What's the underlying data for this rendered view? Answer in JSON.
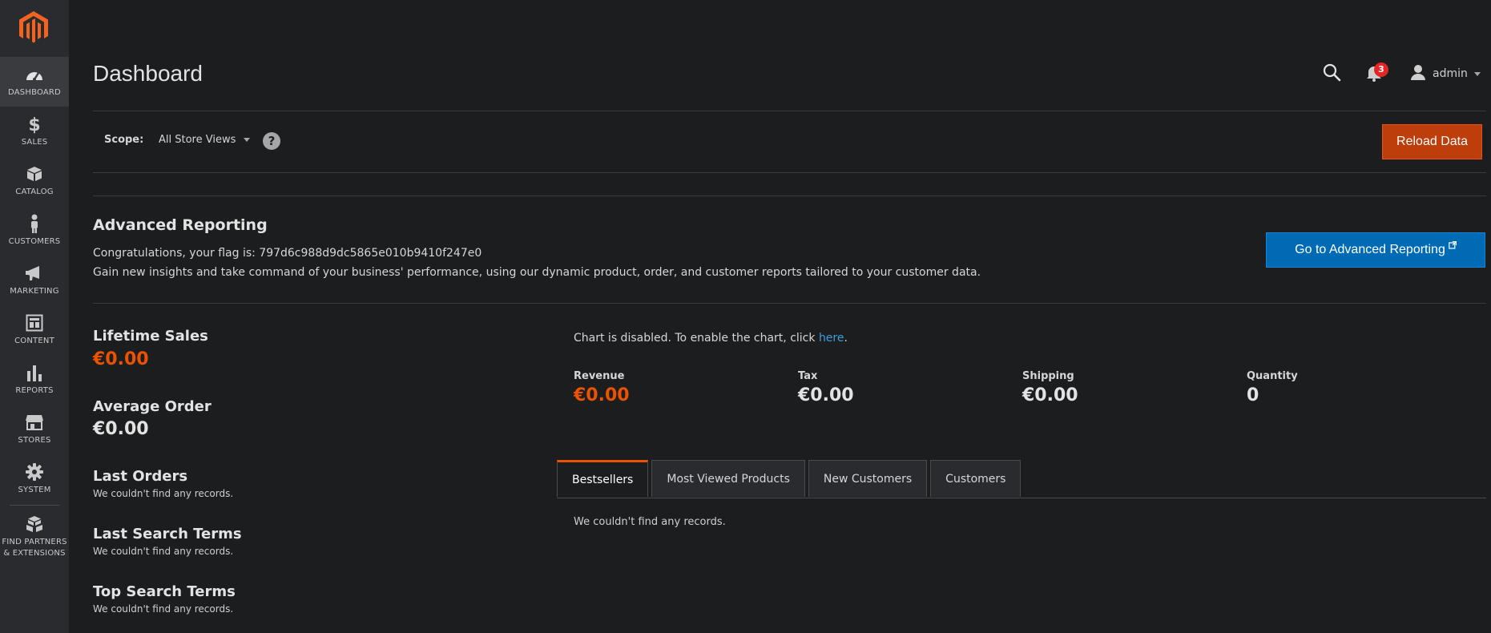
{
  "sidebar": {
    "items": [
      {
        "label": "DASHBOARD",
        "icon": "dashboard-icon"
      },
      {
        "label": "SALES",
        "icon": "dollar-icon"
      },
      {
        "label": "CATALOG",
        "icon": "box-icon"
      },
      {
        "label": "CUSTOMERS",
        "icon": "person-icon"
      },
      {
        "label": "MARKETING",
        "icon": "megaphone-icon"
      },
      {
        "label": "CONTENT",
        "icon": "layout-icon"
      },
      {
        "label": "REPORTS",
        "icon": "bar-chart-icon"
      },
      {
        "label": "STORES",
        "icon": "storefront-icon"
      },
      {
        "label": "SYSTEM",
        "icon": "gear-icon"
      },
      {
        "label": "FIND PARTNERS\n& EXTENSIONS",
        "icon": "cubes-icon"
      }
    ]
  },
  "header": {
    "title": "Dashboard",
    "notifications_count": "3",
    "user": "admin"
  },
  "scope": {
    "label": "Scope:",
    "value": "All Store Views",
    "help": "?",
    "reload_label": "Reload Data"
  },
  "advanced": {
    "title": "Advanced Reporting",
    "line1": "Congratulations, your flag is: 797d6c988d9dc5865e010b9410f247e0",
    "line2": "Gain new insights and take command of your business' performance, using our dynamic product, order, and customer reports tailored to your customer data.",
    "button_label": "Go to Advanced Reporting"
  },
  "stats": {
    "lifetime_title": "Lifetime Sales",
    "lifetime_value": "€0.00",
    "avg_title": "Average Order",
    "avg_value": "€0.00",
    "last_orders_title": "Last Orders",
    "last_orders_empty": "We couldn't find any records.",
    "last_search_title": "Last Search Terms",
    "last_search_empty": "We couldn't find any records.",
    "top_search_title": "Top Search Terms",
    "top_search_empty": "We couldn't find any records."
  },
  "chart": {
    "note_prefix": "Chart is disabled. To enable the chart, click ",
    "note_link": "here",
    "note_suffix": "."
  },
  "totals": [
    {
      "label": "Revenue",
      "value": "€0.00"
    },
    {
      "label": "Tax",
      "value": "€0.00"
    },
    {
      "label": "Shipping",
      "value": "€0.00"
    },
    {
      "label": "Quantity",
      "value": "0"
    }
  ],
  "tabs": {
    "items": [
      "Bestsellers",
      "Most Viewed Products",
      "New Customers",
      "Customers"
    ],
    "active": "Bestsellers",
    "empty": "We couldn't find any records."
  },
  "colors": {
    "accent": "#eb5202",
    "primary_button": "#006bb4",
    "reload_button": "#bd3e0b",
    "link": "#3d9de0"
  }
}
